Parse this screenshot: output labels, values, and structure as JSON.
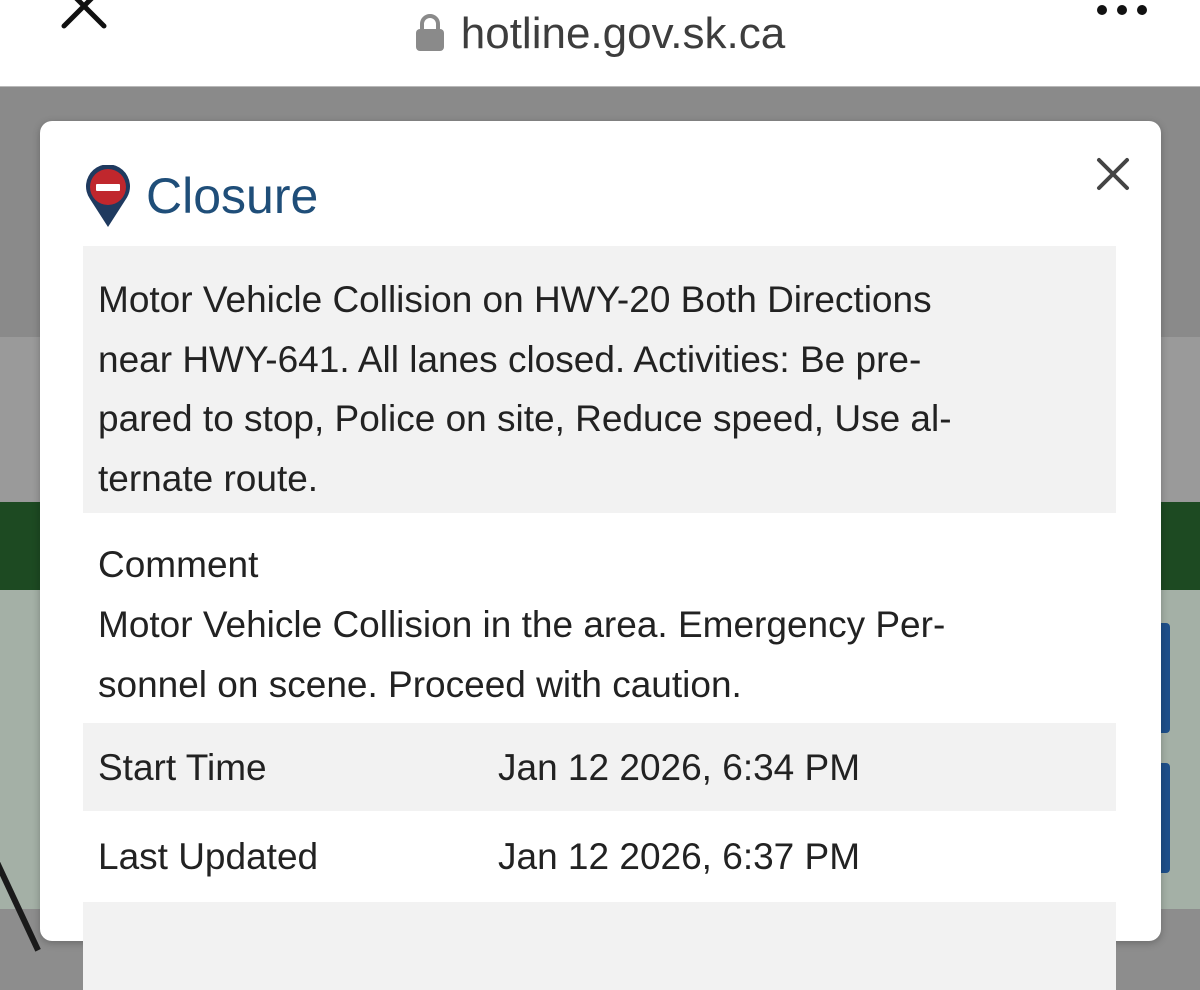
{
  "browser": {
    "url": "hotline.gov.sk.ca"
  },
  "popup": {
    "title": "Closure",
    "description_lines": [
      "Motor Vehicle Collision on HWY-20 Both Directions",
      "near HWY-641. All lanes closed. Activities: Be pre-",
      "pared to stop, Police on site, Reduce speed, Use al-",
      "ternate route."
    ],
    "comment_label": "Comment",
    "comment_lines": [
      "Motor Vehicle Collision in the area. Emergency Per-",
      "sonnel on scene. Proceed with caution."
    ],
    "details": [
      {
        "label": "Start Time",
        "value": "Jan 12 2026, 6:34 PM"
      },
      {
        "label": "Last Updated",
        "value": "Jan 12 2026, 6:37 PM"
      }
    ]
  },
  "colors": {
    "title": "#1f4e79",
    "pin_red": "#c0272d",
    "pin_navy": "#1f3a5f",
    "shaded_row": "#f2f2f2",
    "background_green": "#1d4a22"
  },
  "icons": {
    "browser_close": "close-icon",
    "lock": "lock-icon",
    "more": "more-dots-icon",
    "popup_close": "close-icon",
    "closure": "closure-pin-icon"
  }
}
